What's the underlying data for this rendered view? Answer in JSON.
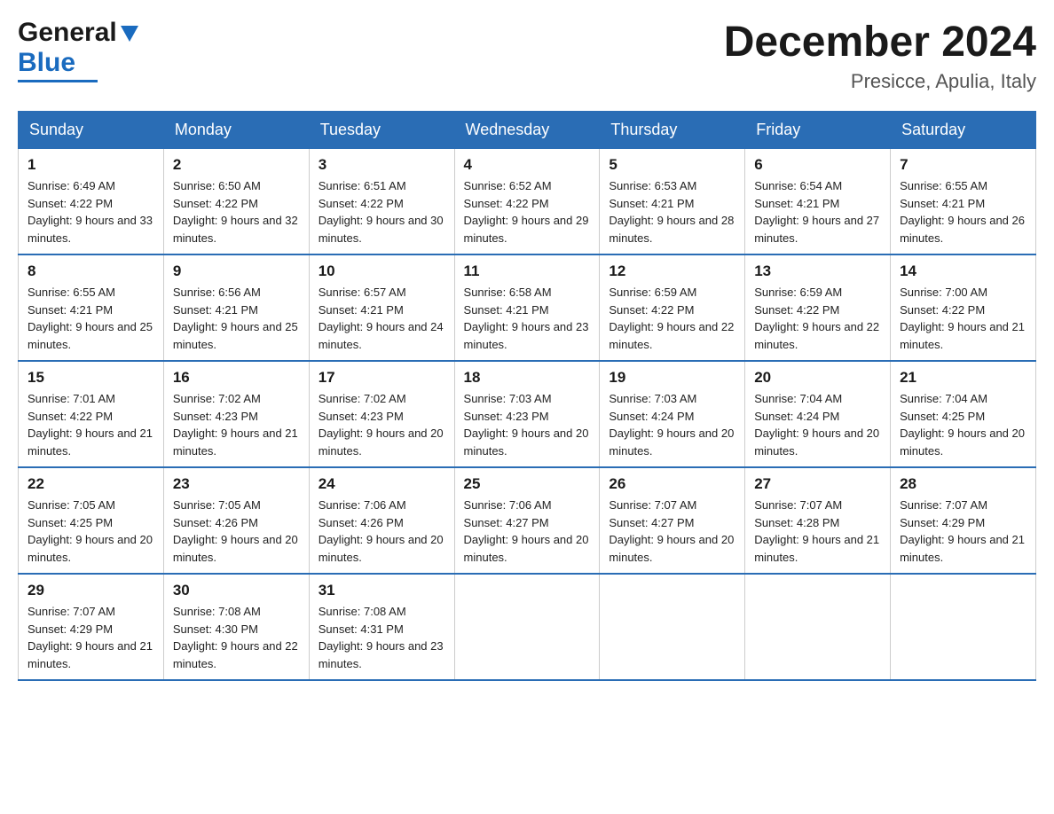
{
  "header": {
    "logo_general": "General",
    "logo_blue": "Blue",
    "month_title": "December 2024",
    "location": "Presicce, Apulia, Italy"
  },
  "days_of_week": [
    "Sunday",
    "Monday",
    "Tuesday",
    "Wednesday",
    "Thursday",
    "Friday",
    "Saturday"
  ],
  "weeks": [
    [
      {
        "day": "1",
        "sunrise": "6:49 AM",
        "sunset": "4:22 PM",
        "daylight": "9 hours and 33 minutes."
      },
      {
        "day": "2",
        "sunrise": "6:50 AM",
        "sunset": "4:22 PM",
        "daylight": "9 hours and 32 minutes."
      },
      {
        "day": "3",
        "sunrise": "6:51 AM",
        "sunset": "4:22 PM",
        "daylight": "9 hours and 30 minutes."
      },
      {
        "day": "4",
        "sunrise": "6:52 AM",
        "sunset": "4:22 PM",
        "daylight": "9 hours and 29 minutes."
      },
      {
        "day": "5",
        "sunrise": "6:53 AM",
        "sunset": "4:21 PM",
        "daylight": "9 hours and 28 minutes."
      },
      {
        "day": "6",
        "sunrise": "6:54 AM",
        "sunset": "4:21 PM",
        "daylight": "9 hours and 27 minutes."
      },
      {
        "day": "7",
        "sunrise": "6:55 AM",
        "sunset": "4:21 PM",
        "daylight": "9 hours and 26 minutes."
      }
    ],
    [
      {
        "day": "8",
        "sunrise": "6:55 AM",
        "sunset": "4:21 PM",
        "daylight": "9 hours and 25 minutes."
      },
      {
        "day": "9",
        "sunrise": "6:56 AM",
        "sunset": "4:21 PM",
        "daylight": "9 hours and 25 minutes."
      },
      {
        "day": "10",
        "sunrise": "6:57 AM",
        "sunset": "4:21 PM",
        "daylight": "9 hours and 24 minutes."
      },
      {
        "day": "11",
        "sunrise": "6:58 AM",
        "sunset": "4:21 PM",
        "daylight": "9 hours and 23 minutes."
      },
      {
        "day": "12",
        "sunrise": "6:59 AM",
        "sunset": "4:22 PM",
        "daylight": "9 hours and 22 minutes."
      },
      {
        "day": "13",
        "sunrise": "6:59 AM",
        "sunset": "4:22 PM",
        "daylight": "9 hours and 22 minutes."
      },
      {
        "day": "14",
        "sunrise": "7:00 AM",
        "sunset": "4:22 PM",
        "daylight": "9 hours and 21 minutes."
      }
    ],
    [
      {
        "day": "15",
        "sunrise": "7:01 AM",
        "sunset": "4:22 PM",
        "daylight": "9 hours and 21 minutes."
      },
      {
        "day": "16",
        "sunrise": "7:02 AM",
        "sunset": "4:23 PM",
        "daylight": "9 hours and 21 minutes."
      },
      {
        "day": "17",
        "sunrise": "7:02 AM",
        "sunset": "4:23 PM",
        "daylight": "9 hours and 20 minutes."
      },
      {
        "day": "18",
        "sunrise": "7:03 AM",
        "sunset": "4:23 PM",
        "daylight": "9 hours and 20 minutes."
      },
      {
        "day": "19",
        "sunrise": "7:03 AM",
        "sunset": "4:24 PM",
        "daylight": "9 hours and 20 minutes."
      },
      {
        "day": "20",
        "sunrise": "7:04 AM",
        "sunset": "4:24 PM",
        "daylight": "9 hours and 20 minutes."
      },
      {
        "day": "21",
        "sunrise": "7:04 AM",
        "sunset": "4:25 PM",
        "daylight": "9 hours and 20 minutes."
      }
    ],
    [
      {
        "day": "22",
        "sunrise": "7:05 AM",
        "sunset": "4:25 PM",
        "daylight": "9 hours and 20 minutes."
      },
      {
        "day": "23",
        "sunrise": "7:05 AM",
        "sunset": "4:26 PM",
        "daylight": "9 hours and 20 minutes."
      },
      {
        "day": "24",
        "sunrise": "7:06 AM",
        "sunset": "4:26 PM",
        "daylight": "9 hours and 20 minutes."
      },
      {
        "day": "25",
        "sunrise": "7:06 AM",
        "sunset": "4:27 PM",
        "daylight": "9 hours and 20 minutes."
      },
      {
        "day": "26",
        "sunrise": "7:07 AM",
        "sunset": "4:27 PM",
        "daylight": "9 hours and 20 minutes."
      },
      {
        "day": "27",
        "sunrise": "7:07 AM",
        "sunset": "4:28 PM",
        "daylight": "9 hours and 21 minutes."
      },
      {
        "day": "28",
        "sunrise": "7:07 AM",
        "sunset": "4:29 PM",
        "daylight": "9 hours and 21 minutes."
      }
    ],
    [
      {
        "day": "29",
        "sunrise": "7:07 AM",
        "sunset": "4:29 PM",
        "daylight": "9 hours and 21 minutes."
      },
      {
        "day": "30",
        "sunrise": "7:08 AM",
        "sunset": "4:30 PM",
        "daylight": "9 hours and 22 minutes."
      },
      {
        "day": "31",
        "sunrise": "7:08 AM",
        "sunset": "4:31 PM",
        "daylight": "9 hours and 23 minutes."
      },
      null,
      null,
      null,
      null
    ]
  ]
}
